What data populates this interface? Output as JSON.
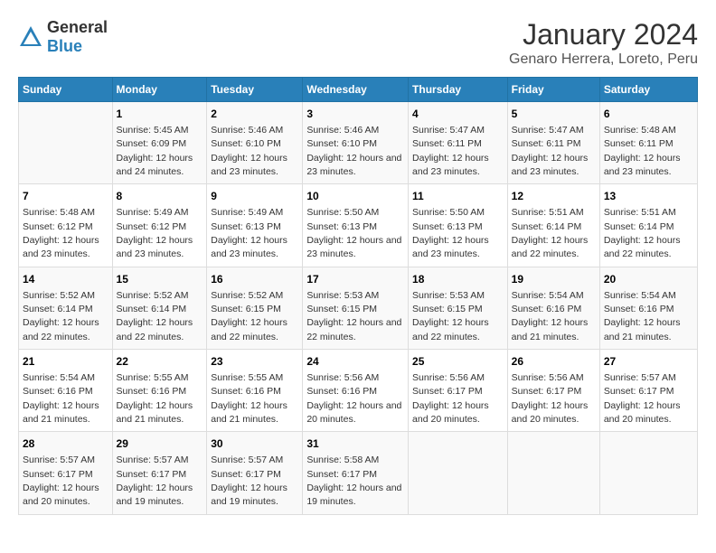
{
  "logo": {
    "general": "General",
    "blue": "Blue"
  },
  "title": "January 2024",
  "subtitle": "Genaro Herrera, Loreto, Peru",
  "weekdays": [
    "Sunday",
    "Monday",
    "Tuesday",
    "Wednesday",
    "Thursday",
    "Friday",
    "Saturday"
  ],
  "weeks": [
    [
      {
        "day": "",
        "sunrise": "",
        "sunset": "",
        "daylight": ""
      },
      {
        "day": "1",
        "sunrise": "Sunrise: 5:45 AM",
        "sunset": "Sunset: 6:09 PM",
        "daylight": "Daylight: 12 hours and 24 minutes."
      },
      {
        "day": "2",
        "sunrise": "Sunrise: 5:46 AM",
        "sunset": "Sunset: 6:10 PM",
        "daylight": "Daylight: 12 hours and 23 minutes."
      },
      {
        "day": "3",
        "sunrise": "Sunrise: 5:46 AM",
        "sunset": "Sunset: 6:10 PM",
        "daylight": "Daylight: 12 hours and 23 minutes."
      },
      {
        "day": "4",
        "sunrise": "Sunrise: 5:47 AM",
        "sunset": "Sunset: 6:11 PM",
        "daylight": "Daylight: 12 hours and 23 minutes."
      },
      {
        "day": "5",
        "sunrise": "Sunrise: 5:47 AM",
        "sunset": "Sunset: 6:11 PM",
        "daylight": "Daylight: 12 hours and 23 minutes."
      },
      {
        "day": "6",
        "sunrise": "Sunrise: 5:48 AM",
        "sunset": "Sunset: 6:11 PM",
        "daylight": "Daylight: 12 hours and 23 minutes."
      }
    ],
    [
      {
        "day": "7",
        "sunrise": "Sunrise: 5:48 AM",
        "sunset": "Sunset: 6:12 PM",
        "daylight": "Daylight: 12 hours and 23 minutes."
      },
      {
        "day": "8",
        "sunrise": "Sunrise: 5:49 AM",
        "sunset": "Sunset: 6:12 PM",
        "daylight": "Daylight: 12 hours and 23 minutes."
      },
      {
        "day": "9",
        "sunrise": "Sunrise: 5:49 AM",
        "sunset": "Sunset: 6:13 PM",
        "daylight": "Daylight: 12 hours and 23 minutes."
      },
      {
        "day": "10",
        "sunrise": "Sunrise: 5:50 AM",
        "sunset": "Sunset: 6:13 PM",
        "daylight": "Daylight: 12 hours and 23 minutes."
      },
      {
        "day": "11",
        "sunrise": "Sunrise: 5:50 AM",
        "sunset": "Sunset: 6:13 PM",
        "daylight": "Daylight: 12 hours and 23 minutes."
      },
      {
        "day": "12",
        "sunrise": "Sunrise: 5:51 AM",
        "sunset": "Sunset: 6:14 PM",
        "daylight": "Daylight: 12 hours and 22 minutes."
      },
      {
        "day": "13",
        "sunrise": "Sunrise: 5:51 AM",
        "sunset": "Sunset: 6:14 PM",
        "daylight": "Daylight: 12 hours and 22 minutes."
      }
    ],
    [
      {
        "day": "14",
        "sunrise": "Sunrise: 5:52 AM",
        "sunset": "Sunset: 6:14 PM",
        "daylight": "Daylight: 12 hours and 22 minutes."
      },
      {
        "day": "15",
        "sunrise": "Sunrise: 5:52 AM",
        "sunset": "Sunset: 6:14 PM",
        "daylight": "Daylight: 12 hours and 22 minutes."
      },
      {
        "day": "16",
        "sunrise": "Sunrise: 5:52 AM",
        "sunset": "Sunset: 6:15 PM",
        "daylight": "Daylight: 12 hours and 22 minutes."
      },
      {
        "day": "17",
        "sunrise": "Sunrise: 5:53 AM",
        "sunset": "Sunset: 6:15 PM",
        "daylight": "Daylight: 12 hours and 22 minutes."
      },
      {
        "day": "18",
        "sunrise": "Sunrise: 5:53 AM",
        "sunset": "Sunset: 6:15 PM",
        "daylight": "Daylight: 12 hours and 22 minutes."
      },
      {
        "day": "19",
        "sunrise": "Sunrise: 5:54 AM",
        "sunset": "Sunset: 6:16 PM",
        "daylight": "Daylight: 12 hours and 21 minutes."
      },
      {
        "day": "20",
        "sunrise": "Sunrise: 5:54 AM",
        "sunset": "Sunset: 6:16 PM",
        "daylight": "Daylight: 12 hours and 21 minutes."
      }
    ],
    [
      {
        "day": "21",
        "sunrise": "Sunrise: 5:54 AM",
        "sunset": "Sunset: 6:16 PM",
        "daylight": "Daylight: 12 hours and 21 minutes."
      },
      {
        "day": "22",
        "sunrise": "Sunrise: 5:55 AM",
        "sunset": "Sunset: 6:16 PM",
        "daylight": "Daylight: 12 hours and 21 minutes."
      },
      {
        "day": "23",
        "sunrise": "Sunrise: 5:55 AM",
        "sunset": "Sunset: 6:16 PM",
        "daylight": "Daylight: 12 hours and 21 minutes."
      },
      {
        "day": "24",
        "sunrise": "Sunrise: 5:56 AM",
        "sunset": "Sunset: 6:16 PM",
        "daylight": "Daylight: 12 hours and 20 minutes."
      },
      {
        "day": "25",
        "sunrise": "Sunrise: 5:56 AM",
        "sunset": "Sunset: 6:17 PM",
        "daylight": "Daylight: 12 hours and 20 minutes."
      },
      {
        "day": "26",
        "sunrise": "Sunrise: 5:56 AM",
        "sunset": "Sunset: 6:17 PM",
        "daylight": "Daylight: 12 hours and 20 minutes."
      },
      {
        "day": "27",
        "sunrise": "Sunrise: 5:57 AM",
        "sunset": "Sunset: 6:17 PM",
        "daylight": "Daylight: 12 hours and 20 minutes."
      }
    ],
    [
      {
        "day": "28",
        "sunrise": "Sunrise: 5:57 AM",
        "sunset": "Sunset: 6:17 PM",
        "daylight": "Daylight: 12 hours and 20 minutes."
      },
      {
        "day": "29",
        "sunrise": "Sunrise: 5:57 AM",
        "sunset": "Sunset: 6:17 PM",
        "daylight": "Daylight: 12 hours and 19 minutes."
      },
      {
        "day": "30",
        "sunrise": "Sunrise: 5:57 AM",
        "sunset": "Sunset: 6:17 PM",
        "daylight": "Daylight: 12 hours and 19 minutes."
      },
      {
        "day": "31",
        "sunrise": "Sunrise: 5:58 AM",
        "sunset": "Sunset: 6:17 PM",
        "daylight": "Daylight: 12 hours and 19 minutes."
      },
      {
        "day": "",
        "sunrise": "",
        "sunset": "",
        "daylight": ""
      },
      {
        "day": "",
        "sunrise": "",
        "sunset": "",
        "daylight": ""
      },
      {
        "day": "",
        "sunrise": "",
        "sunset": "",
        "daylight": ""
      }
    ]
  ]
}
